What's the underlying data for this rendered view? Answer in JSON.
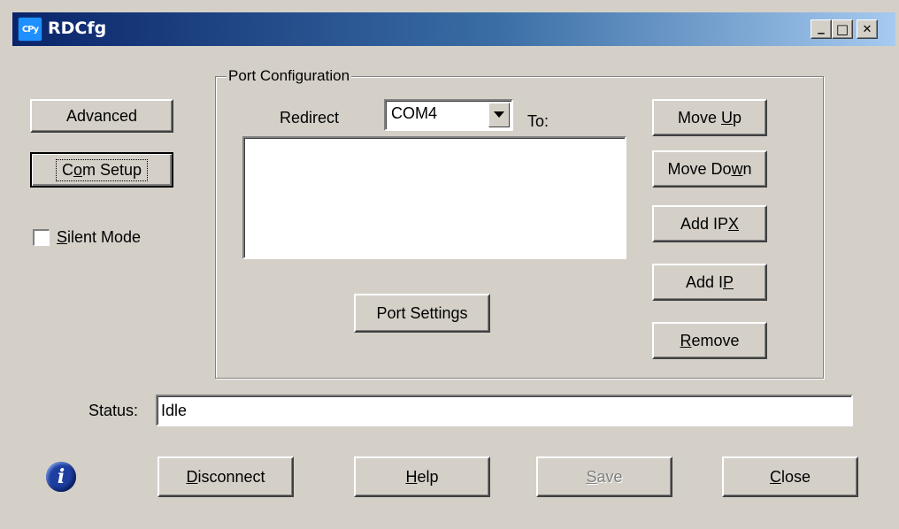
{
  "window": {
    "title": "RDCfg",
    "app_icon_text": "CPy",
    "controls": {
      "minimize": "_",
      "maximize": "□",
      "close": "✕"
    }
  },
  "left": {
    "advanced_label": "Advanced",
    "com_setup": {
      "pre": "C",
      "mnemonic": "o",
      "post": "m Setup"
    },
    "silent_mode": {
      "pre": "",
      "mnemonic": "S",
      "post": "ilent Mode",
      "checked": false
    }
  },
  "port_config": {
    "group_label": "Port Configuration",
    "redirect_label": "Redirect",
    "port_selected": "COM4",
    "to_label": "To:",
    "port_settings_label": "Port Settings",
    "list_items": []
  },
  "right_buttons": {
    "move_up": {
      "pre": "Move ",
      "mnemonic": "U",
      "post": "p"
    },
    "move_down": {
      "pre": "Move Do",
      "mnemonic": "w",
      "post": "n"
    },
    "add_ipx": {
      "pre": "Add IP",
      "mnemonic": "X",
      "post": ""
    },
    "add_ip": {
      "pre": "Add I",
      "mnemonic": "P",
      "post": ""
    },
    "remove": {
      "pre": "",
      "mnemonic": "R",
      "post": "emove"
    }
  },
  "status": {
    "label": "Status:",
    "value": "Idle"
  },
  "bottom": {
    "info_icon": "i",
    "disconnect": {
      "pre": "",
      "mnemonic": "D",
      "post": "isconnect"
    },
    "help": {
      "pre": "",
      "mnemonic": "H",
      "post": "elp"
    },
    "save": {
      "pre": "",
      "mnemonic": "S",
      "post": "ave",
      "enabled": false
    },
    "close": {
      "pre": "",
      "mnemonic": "C",
      "post": "lose"
    }
  }
}
